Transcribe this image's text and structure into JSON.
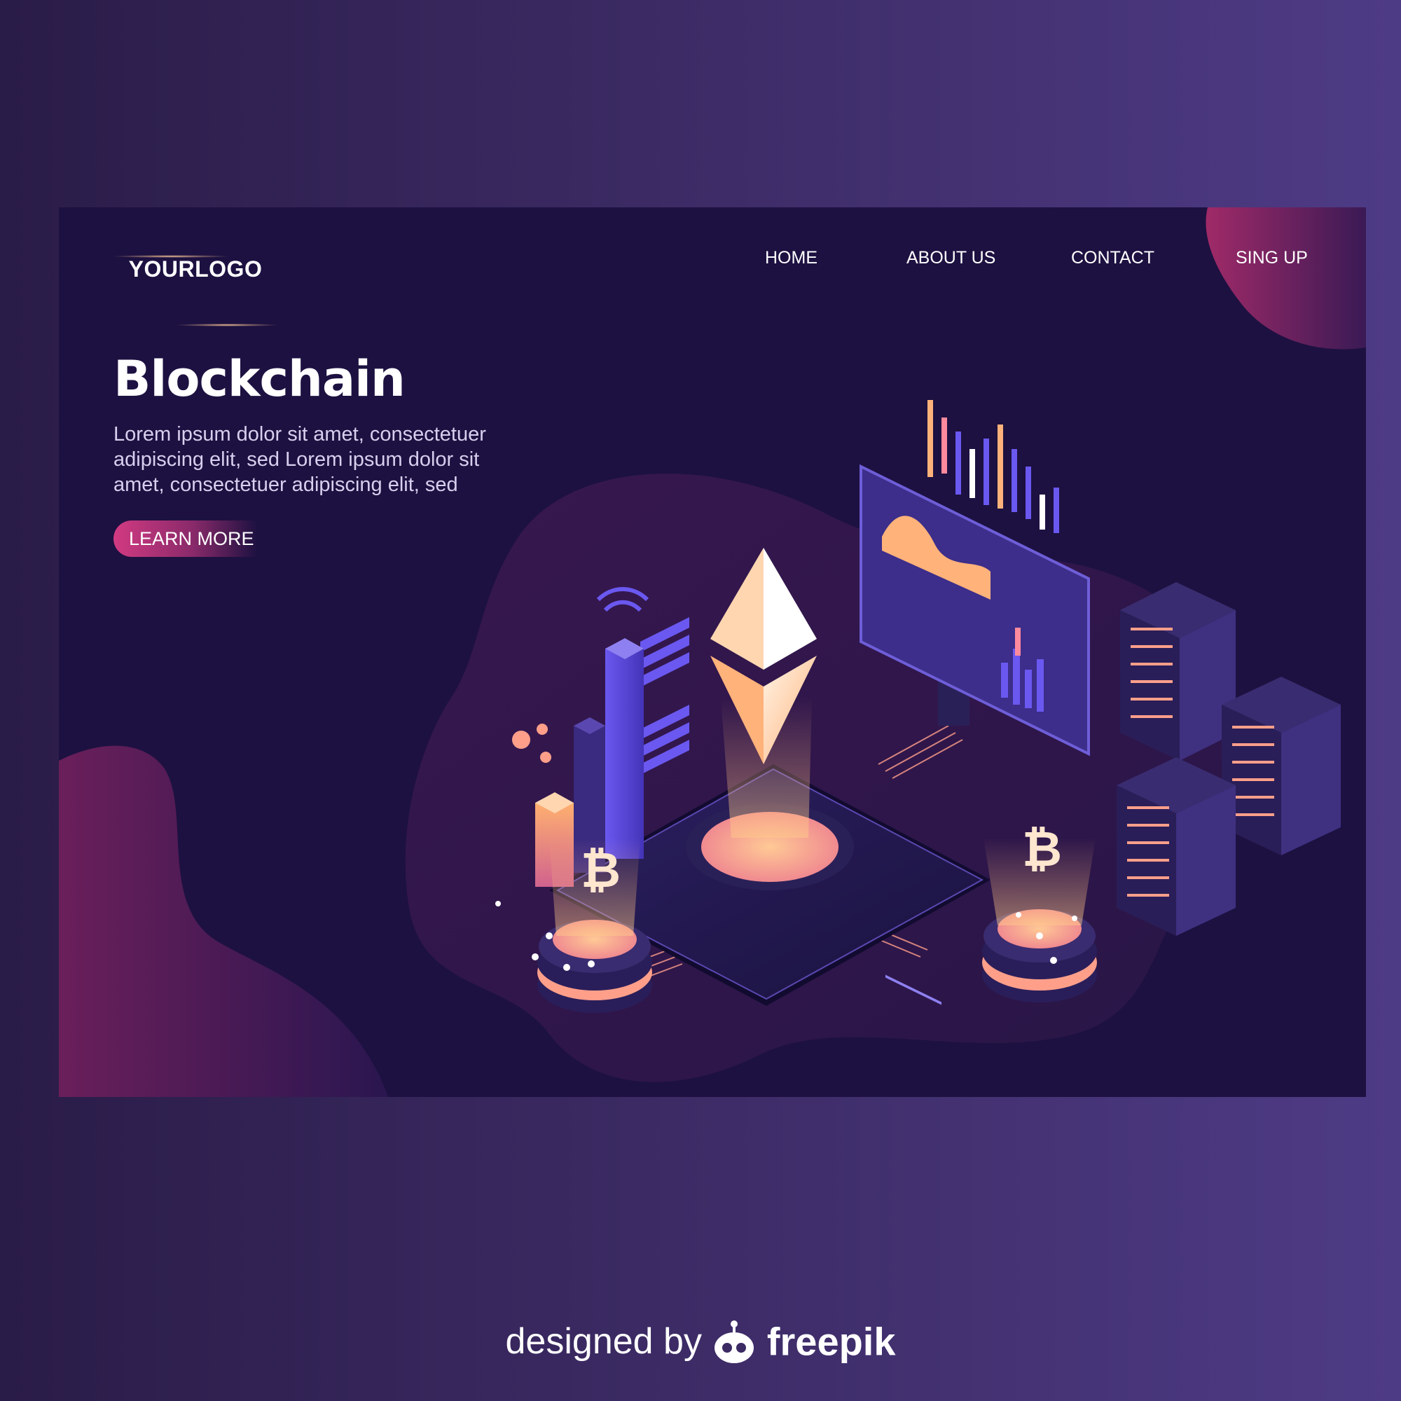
{
  "logo": {
    "text": "YOURLOGO"
  },
  "nav": {
    "items": [
      {
        "label": "HOME"
      },
      {
        "label": "ABOUT US"
      },
      {
        "label": "CONTACT"
      },
      {
        "label": "SING UP"
      }
    ]
  },
  "hero": {
    "title": "Blockchain",
    "body": "Lorem ipsum dolor sit amet, consectetuer adipiscing elit, sed Lorem ipsum dolor sit amet, consectetuer adipiscing elit, sed",
    "button_label": "LEARN MORE"
  },
  "credit": {
    "prefix": "designed by",
    "brand": "freepik",
    "brand_icon": "freepik-logo-icon"
  },
  "colors": {
    "page_bg_left": "#2a1c48",
    "page_bg_right": "#4e3b86",
    "card_bg": "#1d1141",
    "accent_pink": "#d23a82",
    "accent_orange": "#ffb07a",
    "accent_violet": "#5a48e0"
  }
}
